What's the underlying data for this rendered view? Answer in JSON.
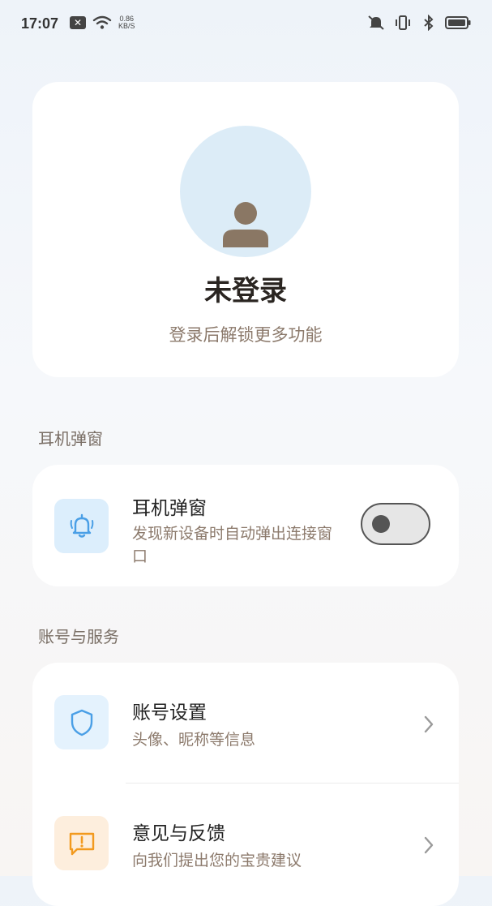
{
  "status_bar": {
    "time": "17:07",
    "net_speed_value": "0.86",
    "net_speed_unit": "KB/S",
    "icons": [
      "notification-x-icon",
      "wifi-icon",
      "mute-icon",
      "vibrate-icon",
      "bluetooth-icon",
      "battery-icon"
    ]
  },
  "profile": {
    "title": "未登录",
    "subtitle": "登录后解锁更多功能",
    "avatar_icon": "user-icon"
  },
  "sections": {
    "earphone_label": "耳机弹窗",
    "account_label": "账号与服务"
  },
  "earphone_popup": {
    "title": "耳机弹窗",
    "description": "发现新设备时自动弹出连接窗口",
    "icon": "bell-icon",
    "toggle_on": false
  },
  "account_items": [
    {
      "title": "账号设置",
      "subtitle": "头像、昵称等信息",
      "icon": "shield-icon"
    },
    {
      "title": "意见与反馈",
      "subtitle": "向我们提出您的宝贵建议",
      "icon": "feedback-icon"
    }
  ],
  "colors": {
    "accent_blue": "#4a9fe6",
    "feedback_orange": "#f29a1f",
    "subtext": "#8c7a6c"
  }
}
